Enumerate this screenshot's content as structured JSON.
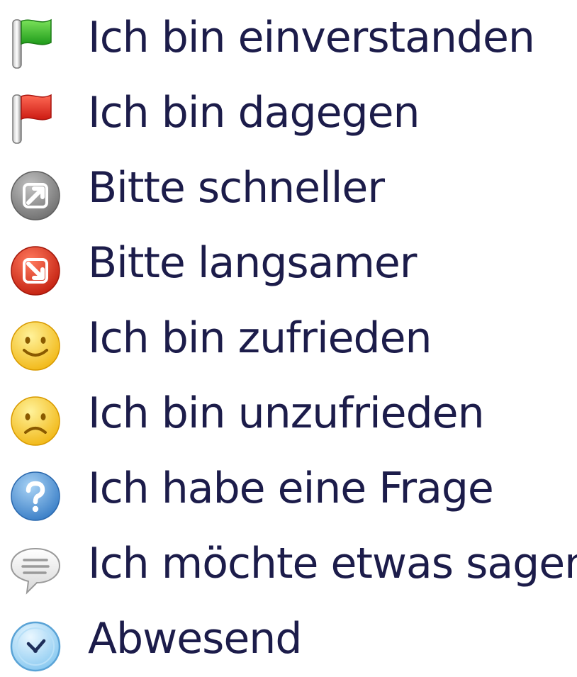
{
  "menu": {
    "items": [
      {
        "id": "agree",
        "label": "Ich bin einverstanden",
        "icon": "green-flag-icon"
      },
      {
        "id": "disagree",
        "label": "Ich bin dagegen",
        "icon": "red-flag-icon"
      },
      {
        "id": "faster",
        "label": "Bitte schneller",
        "icon": "faster-arrow-icon"
      },
      {
        "id": "slower",
        "label": "Bitte langsamer",
        "icon": "slower-arrow-icon"
      },
      {
        "id": "satisfied",
        "label": "Ich bin zufrieden",
        "icon": "smiley-happy-icon"
      },
      {
        "id": "unsatisfied",
        "label": "Ich bin unzufrieden",
        "icon": "smiley-sad-icon"
      },
      {
        "id": "question",
        "label": "Ich habe eine Frage",
        "icon": "question-icon"
      },
      {
        "id": "say",
        "label": "Ich möchte etwas sagen",
        "icon": "speech-bubble-icon"
      },
      {
        "id": "away",
        "label": "Abwesend",
        "icon": "clock-icon"
      }
    ]
  },
  "colors": {
    "text": "#1c1c4a",
    "green_flag": "#2fb82a",
    "red_flag": "#e02a1e",
    "gray_button": "#8c8c8c",
    "red_button": "#d8311d",
    "smiley_yellow": "#f5c21b",
    "question_blue": "#4a8fd0",
    "clock_blue": "#9dd2f2"
  }
}
